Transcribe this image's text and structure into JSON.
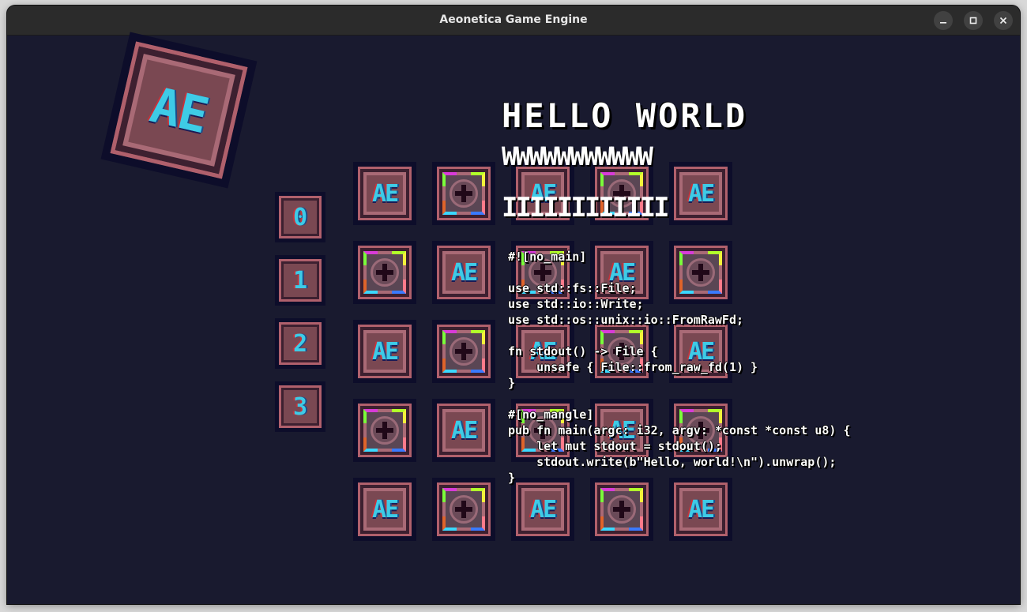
{
  "window": {
    "title": "Aeonetica Game Engine",
    "controls": [
      "minimize",
      "maximize",
      "close"
    ]
  },
  "scene": {
    "logo_text": "AE",
    "number_tiles": [
      "0",
      "1",
      "2",
      "3"
    ],
    "grid": [
      [
        "ae",
        "gear",
        "ae",
        "gear",
        "ae"
      ],
      [
        "gear",
        "ae",
        "gear",
        "ae",
        "gear"
      ],
      [
        "ae",
        "gear",
        "ae",
        "gear",
        "ae"
      ],
      [
        "gear",
        "ae",
        "gear",
        "ae",
        "gear"
      ],
      [
        "ae",
        "gear",
        "ae",
        "gear",
        "ae"
      ]
    ],
    "hello_text": "HELLO WORLD",
    "w_line": "WWWWWWWWWWW",
    "i_line": "IIIIIIIIIIII",
    "code_lines": [
      "#![no_main]",
      "",
      "use std::fs::File;",
      "use std::io::Write;",
      "use std::os::unix::io::FromRawFd;",
      "",
      "fn stdout() -> File {",
      "    unsafe { File::from_raw_fd(1) }",
      "}",
      "",
      "#[no_mangle]",
      "pub fn main(argc: i32, argv: *const *const u8) {",
      "    let mut stdout = stdout();",
      "    stdout.write(b\"Hello, world!\\n\").unwrap();",
      "}"
    ]
  },
  "colors": {
    "background": "#191a2f",
    "titlebar": "#2b2b2b",
    "tile_glyph": "#3ecbe6",
    "tile_frame": "#b0606c"
  }
}
